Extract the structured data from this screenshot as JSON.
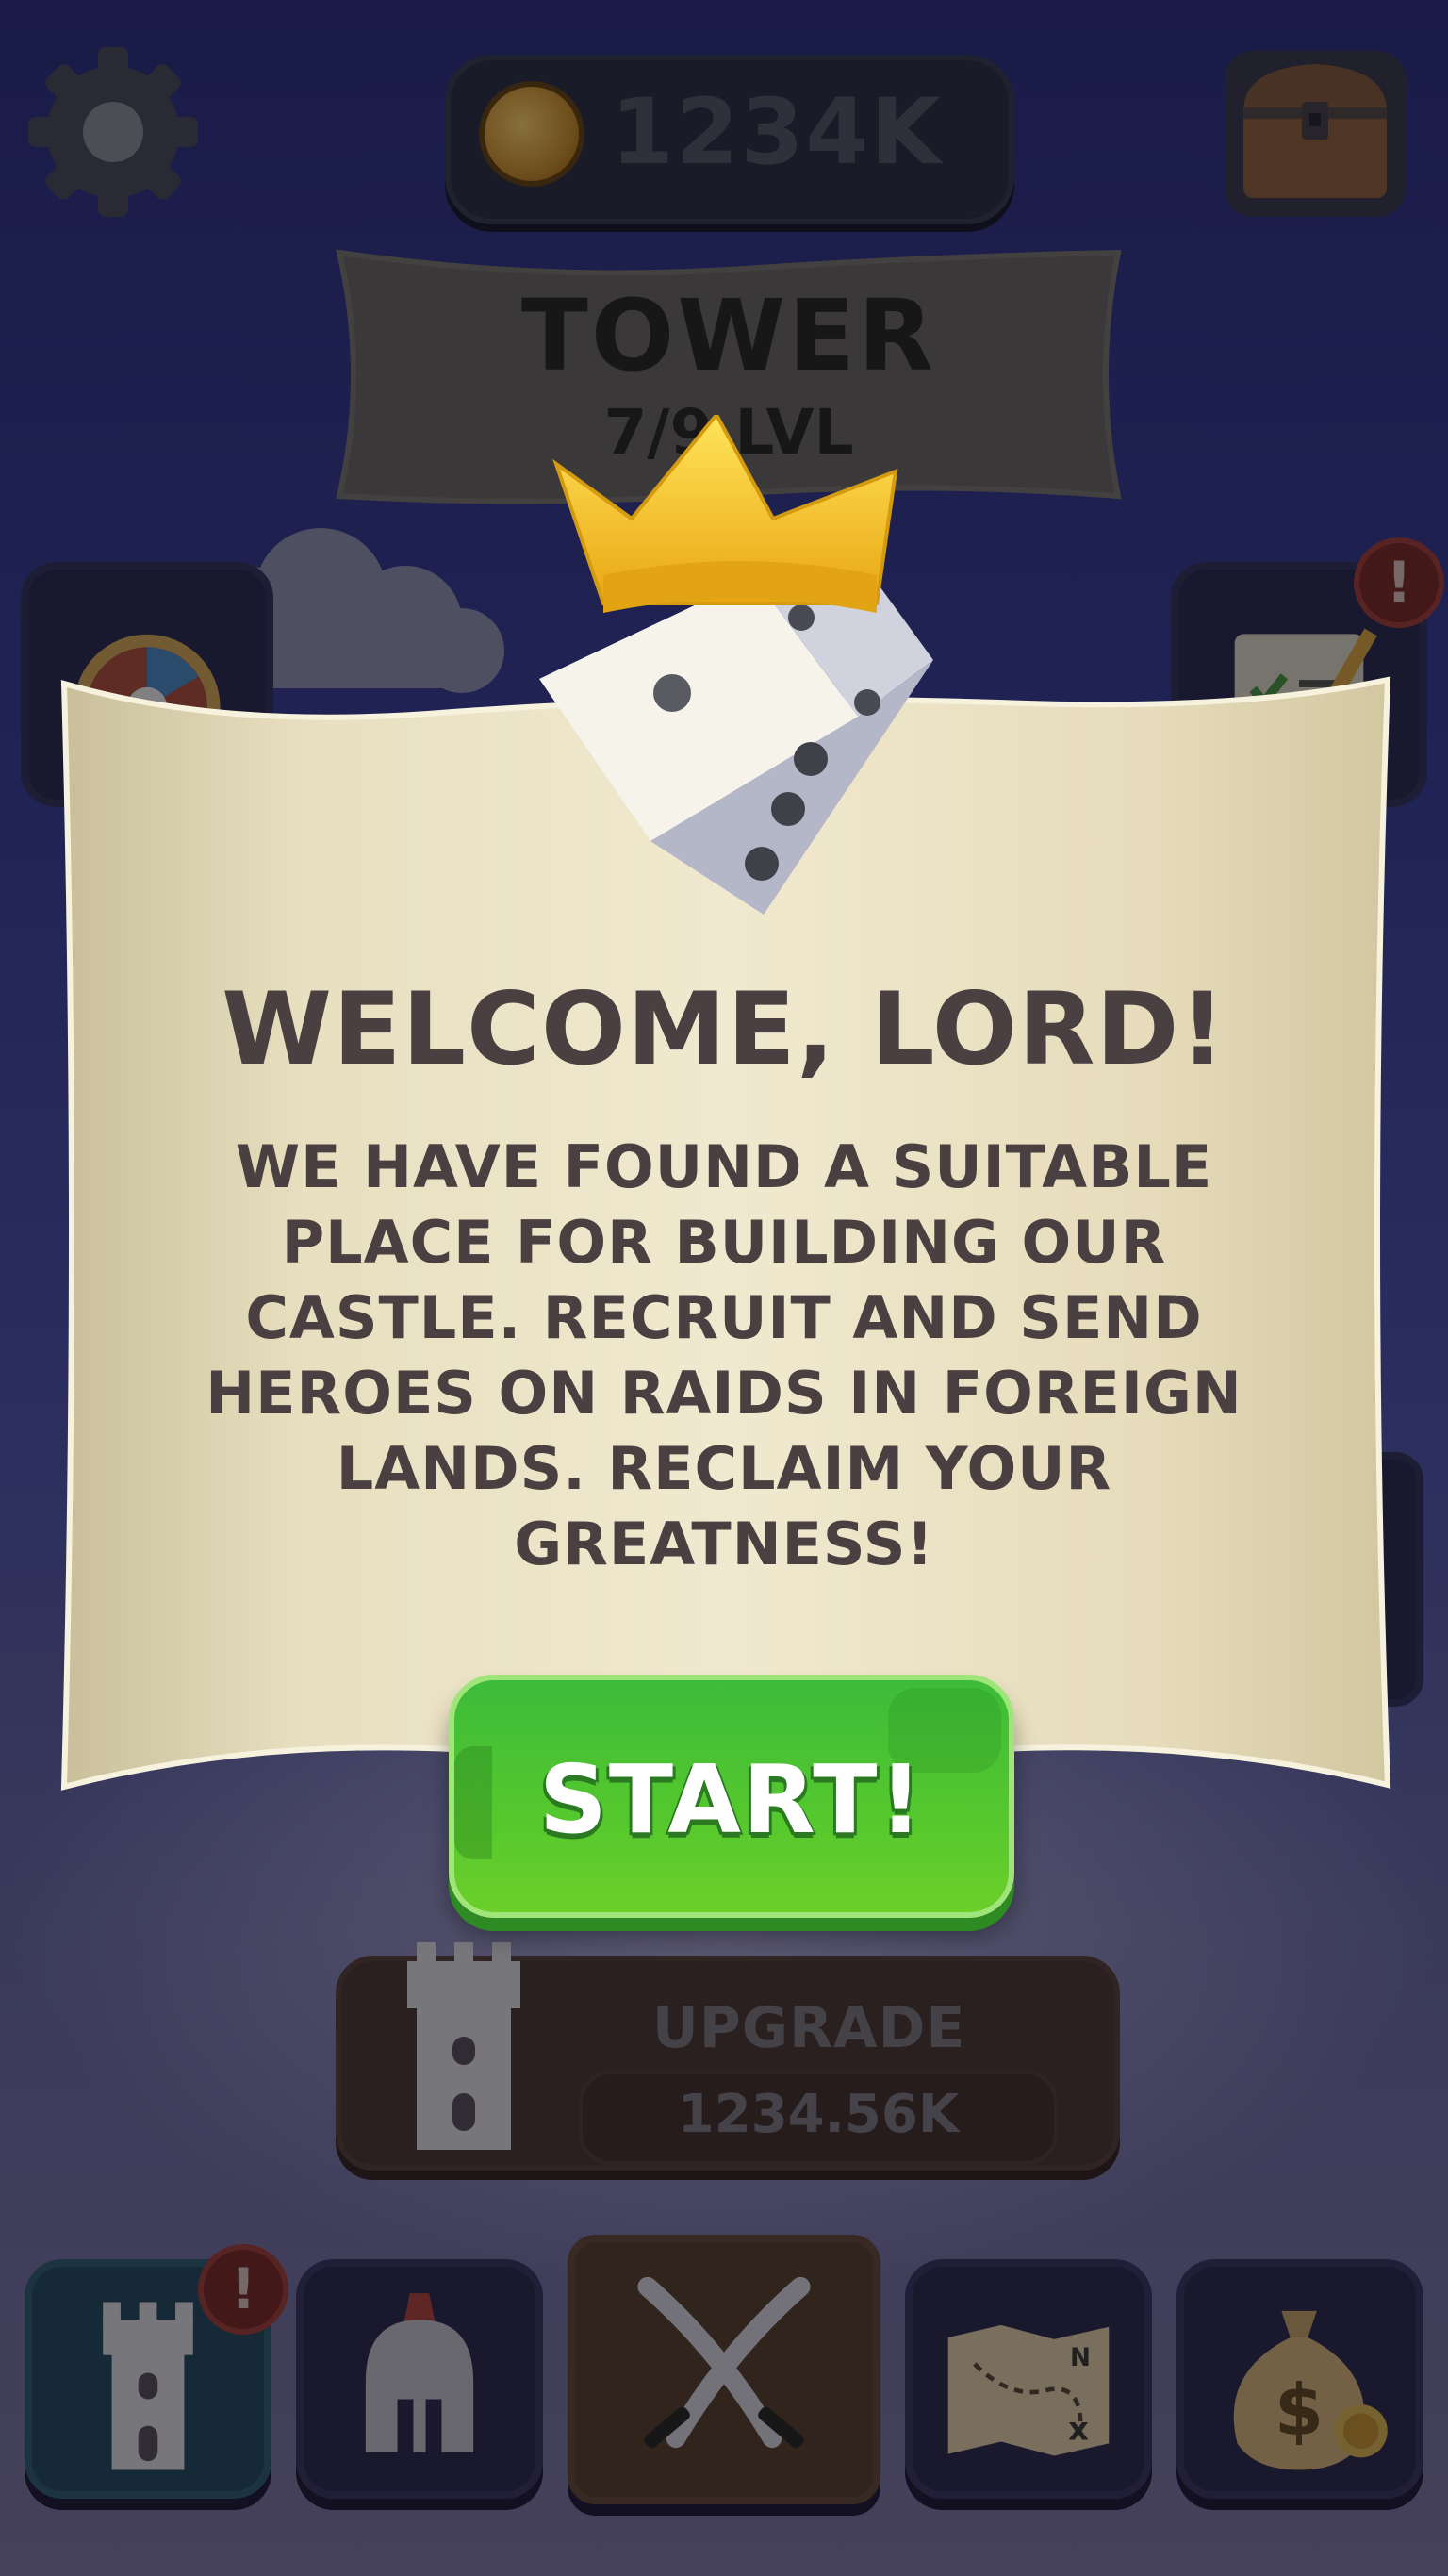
{
  "top_bar": {
    "coins": "1234K",
    "settings_icon": "gear-icon",
    "coin_icon": "clover-coin-icon",
    "chest_icon": "treasure-chest-icon"
  },
  "tower": {
    "title": "TOWER",
    "level": "7/9 LVL"
  },
  "dialog": {
    "title": "WELCOME, LORD!",
    "body": "WE HAVE FOUND A SUITABLE PLACE FOR BUILDING OUR CASTLE. RECRUIT AND SEND HEROES ON RAIDS IN FOREIGN LANDS. RECLAIM YOUR GREATNESS!",
    "button": "START!",
    "icon": "crowned-dice-icon"
  },
  "upgrade": {
    "label": "UPGRADE",
    "price": "1234.56K"
  },
  "side": {
    "alert": "!"
  },
  "nav": {
    "tabs": [
      {
        "icon": "castle-tower-icon",
        "alert": "!"
      },
      {
        "icon": "spartan-helmet-icon"
      },
      {
        "icon": "crossed-swords-icon"
      },
      {
        "icon": "treasure-map-icon"
      },
      {
        "icon": "money-bag-icon"
      }
    ]
  },
  "colors": {
    "background": "#1a1b47",
    "scroll": "#efe6c6",
    "start_button": "#4fc42e",
    "text_dark": "#4a4041"
  }
}
